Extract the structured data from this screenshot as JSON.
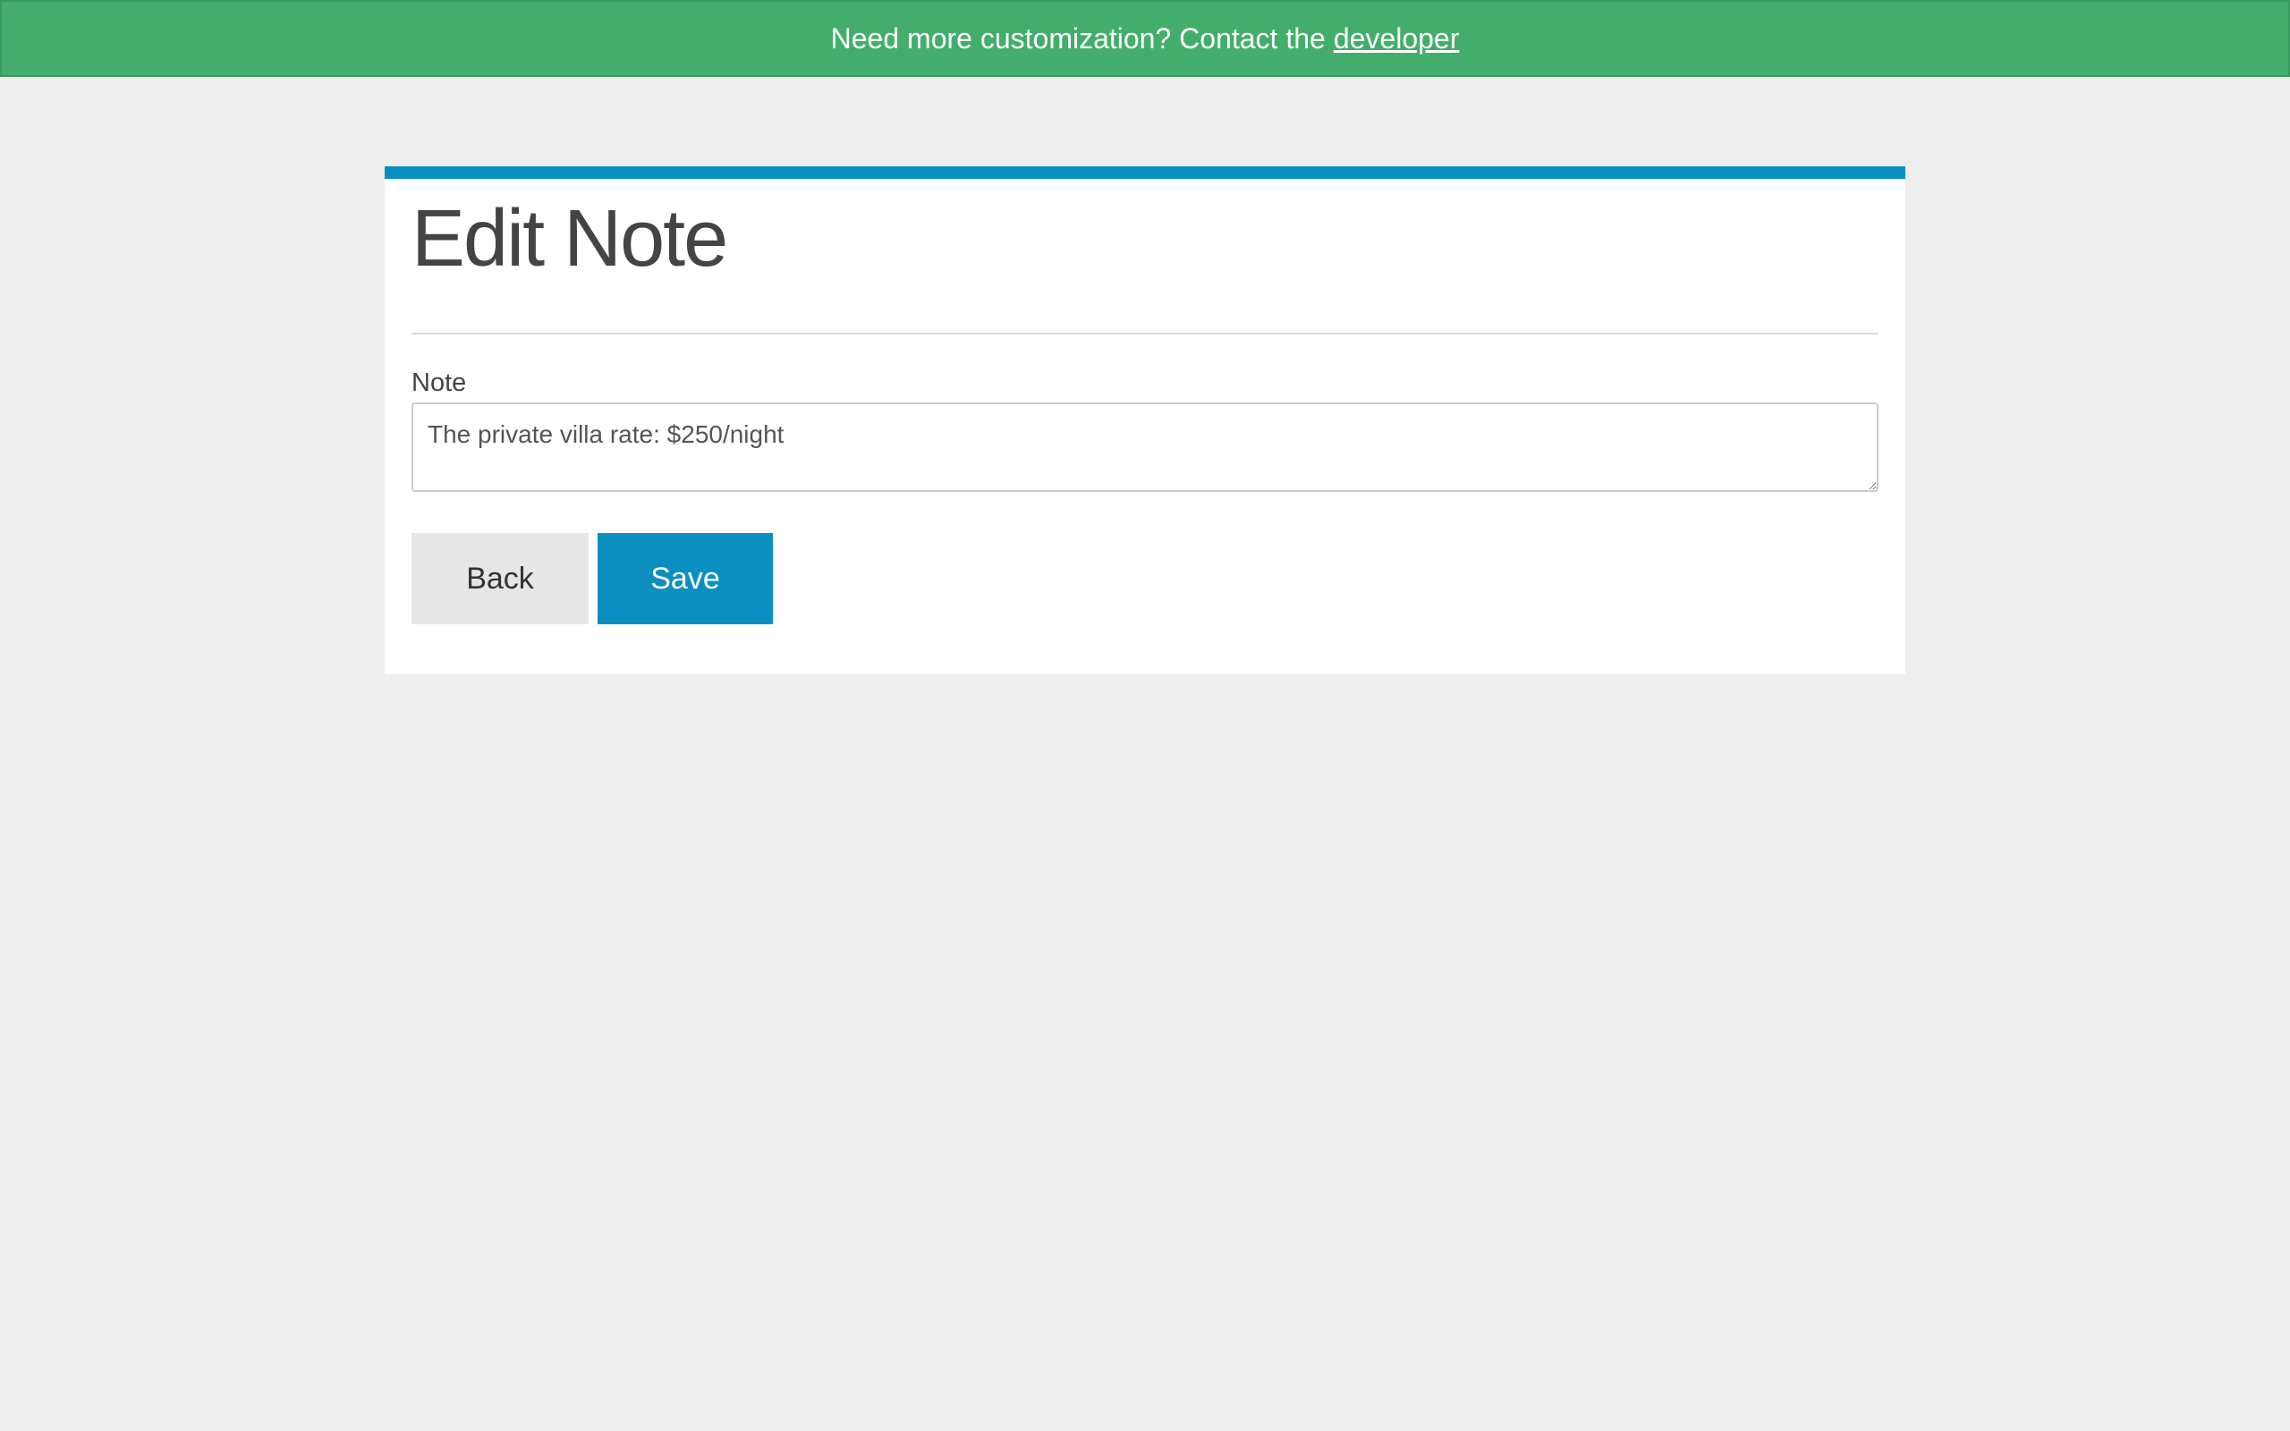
{
  "banner": {
    "text": "Need more customization? Contact the",
    "link_text": "developer",
    "background_color": "#43ae6c"
  },
  "card": {
    "title": "Edit Note",
    "accent_color": "#0a8fc0",
    "form": {
      "note_label": "Note",
      "note_value": "The private villa rate: $250/night"
    },
    "buttons": {
      "back_label": "Back",
      "save_label": "Save"
    }
  }
}
